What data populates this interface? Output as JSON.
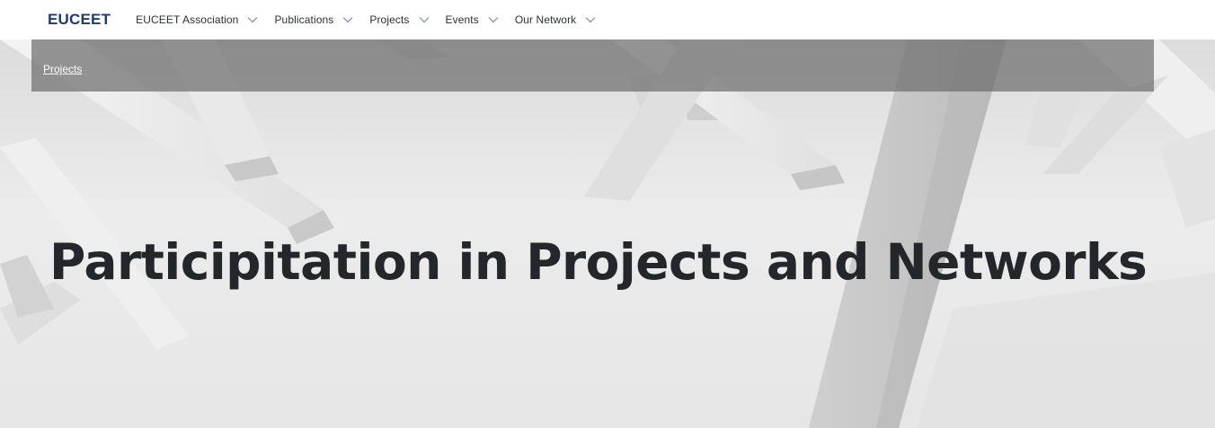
{
  "header": {
    "brand": "EUCEET",
    "nav": [
      {
        "label": "EUCEET Association",
        "icon": "chevron-down-icon"
      },
      {
        "label": "Publications",
        "icon": "chevron-down-icon"
      },
      {
        "label": "Projects",
        "icon": "chevron-down-icon"
      },
      {
        "label": "Events",
        "icon": "chevron-down-icon"
      },
      {
        "label": "Our Network",
        "icon": "chevron-down-icon"
      }
    ]
  },
  "breadcrumb": {
    "current": "Projects"
  },
  "hero": {
    "title": "Participitation in Projects and Networks"
  },
  "colors": {
    "brand": "#1d3a78",
    "title": "#23262b",
    "breadcrumb_bg": "#6e6e6e"
  }
}
